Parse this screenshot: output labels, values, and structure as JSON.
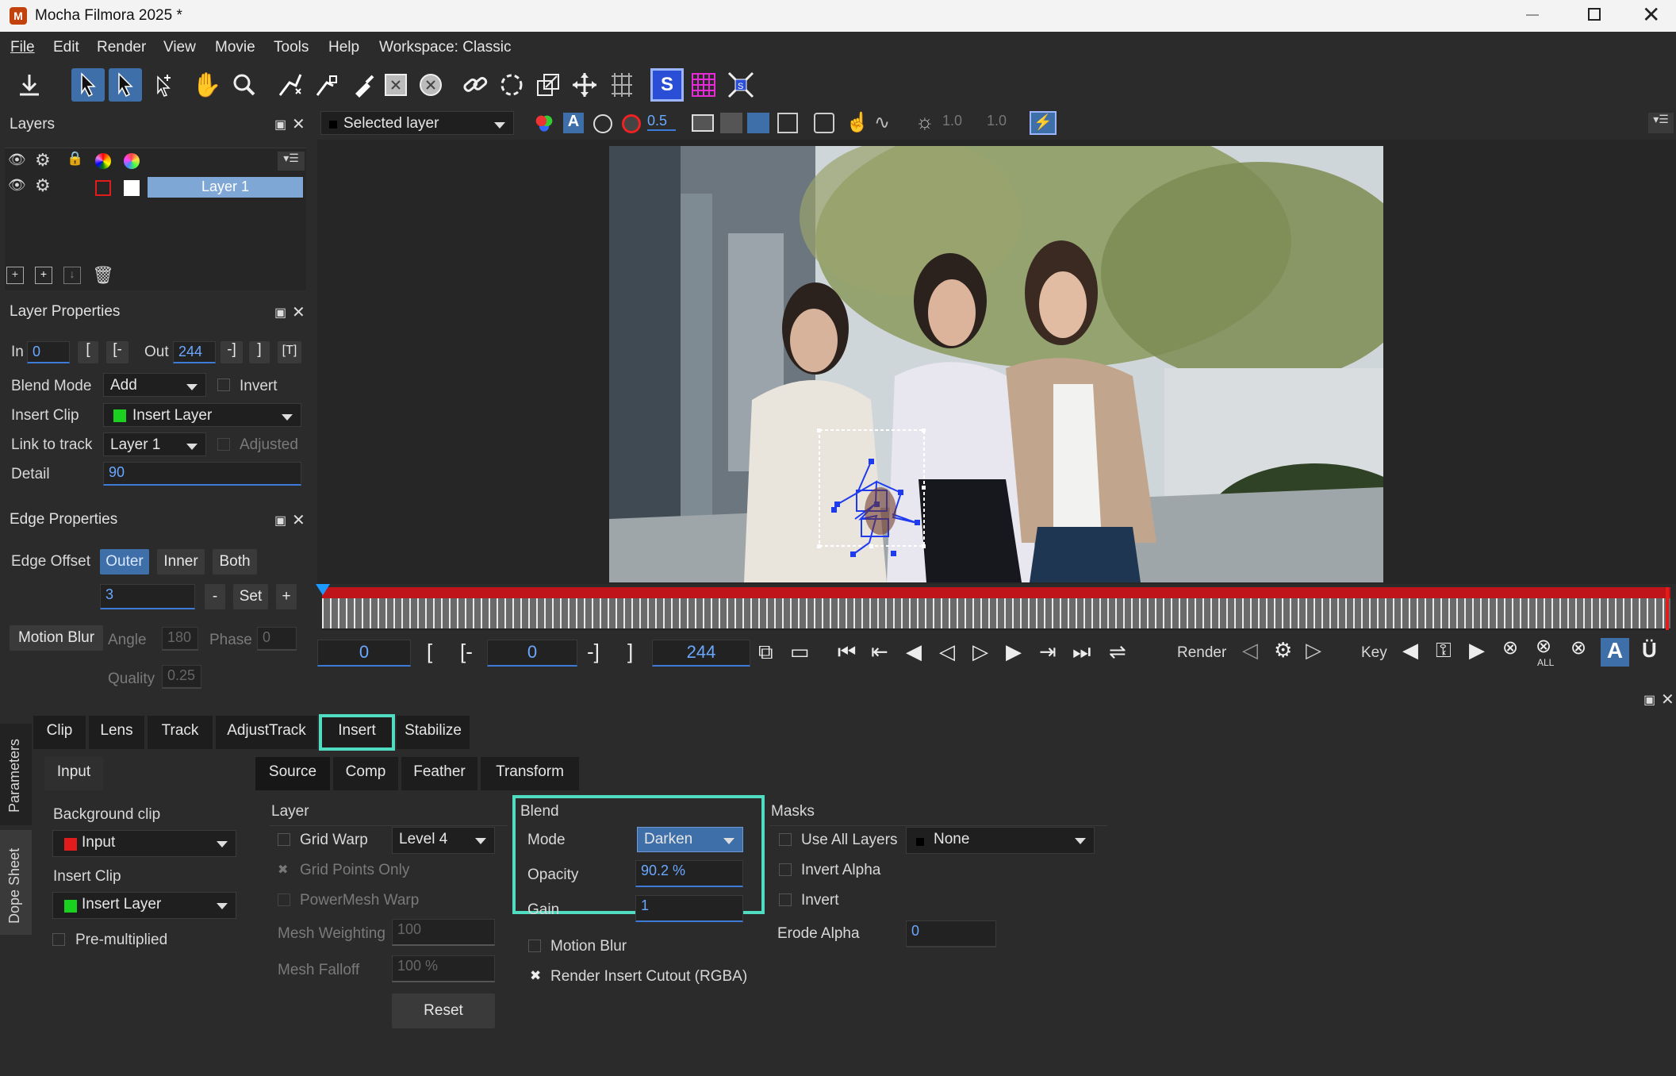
{
  "app": {
    "title": "Mocha Filmora 2025 *"
  },
  "menu": [
    "File",
    "Edit",
    "Render",
    "View",
    "Movie",
    "Tools",
    "Help",
    "Workspace: Classic"
  ],
  "viewer_bar": {
    "layer_select": "Selected layer",
    "opacity": "0.5",
    "val1": "1.0",
    "val2": "1.0"
  },
  "layers": {
    "title": "Layers",
    "items": [
      {
        "name": "Layer 1"
      }
    ]
  },
  "layer_props": {
    "title": "Layer Properties",
    "in_label": "In",
    "in_value": "0",
    "out_label": "Out",
    "out_value": "244",
    "blend_label": "Blend Mode",
    "blend_value": "Add",
    "invert_label": "Invert",
    "insert_label": "Insert Clip",
    "insert_value": "Insert Layer",
    "link_label": "Link to track",
    "link_value": "Layer 1",
    "adjusted_label": "Adjusted",
    "detail_label": "Detail",
    "detail_value": "90",
    "bracket_open": "[",
    "bracket_open_dash": "[-",
    "dash_bracket": "-]",
    "bracket_close": "]",
    "bracket_T": "[T]"
  },
  "edge_props": {
    "title": "Edge Properties",
    "offset_label": "Edge Offset",
    "outer": "Outer",
    "inner": "Inner",
    "both": "Both",
    "value": "3",
    "minus": "-",
    "set": "Set",
    "plus": "+",
    "motion_blur": "Motion Blur",
    "angle_label": "Angle",
    "angle_value": "180",
    "phase_label": "Phase",
    "phase_value": "0",
    "quality_label": "Quality",
    "quality_value": "0.25"
  },
  "transport": {
    "current": "0",
    "in": "0",
    "out": "244",
    "bracket_open": "[",
    "bracket_open_dash": "[-",
    "dash_bracket": "-]",
    "bracket_close": "]",
    "render_label": "Render",
    "key_label": "Key",
    "all_label": "ALL",
    "playhead_fraction": 0.0
  },
  "params": {
    "side_tabs": [
      "Parameters",
      "Dope Sheet"
    ],
    "tabs": [
      "Clip",
      "Lens",
      "Track",
      "AdjustTrack",
      "Insert",
      "Stabilize"
    ],
    "active_tab": "Insert",
    "input_tab": "Input",
    "sub_tabs": [
      "Source",
      "Comp",
      "Feather",
      "Transform"
    ],
    "background_clip_label": "Background clip",
    "background_clip_value": "Input",
    "insert_clip_label": "Insert Clip",
    "insert_clip_value": "Insert Layer",
    "premultiplied_label": "Pre-multiplied",
    "layer_group": "Layer",
    "grid_warp": "Grid Warp",
    "grid_level": "Level 4",
    "grid_points_only": "Grid Points Only",
    "powermesh": "PowerMesh Warp",
    "mesh_weighting_label": "Mesh Weighting",
    "mesh_weighting": "100",
    "mesh_falloff_label": "Mesh Falloff",
    "mesh_falloff": "100 %",
    "reset": "Reset",
    "blend_group": "Blend",
    "mode_label": "Mode",
    "mode_value": "Darken",
    "opacity_label": "Opacity",
    "opacity_value": "90.2 %",
    "gain_label": "Gain",
    "gain_value": "1",
    "motion_blur": "Motion Blur",
    "render_cutout": "Render Insert Cutout (RGBA)",
    "masks_group": "Masks",
    "use_all_layers": "Use All Layers",
    "masks_value": "None",
    "invert_alpha": "Invert Alpha",
    "invert": "Invert",
    "erode_alpha_label": "Erode Alpha",
    "erode_alpha_value": "0"
  },
  "colors": {
    "accent": "#3f6fa8",
    "highlight": "#4fdcc0",
    "timeline_red": "#c0141b",
    "link_blue": "#6aa8ff"
  }
}
